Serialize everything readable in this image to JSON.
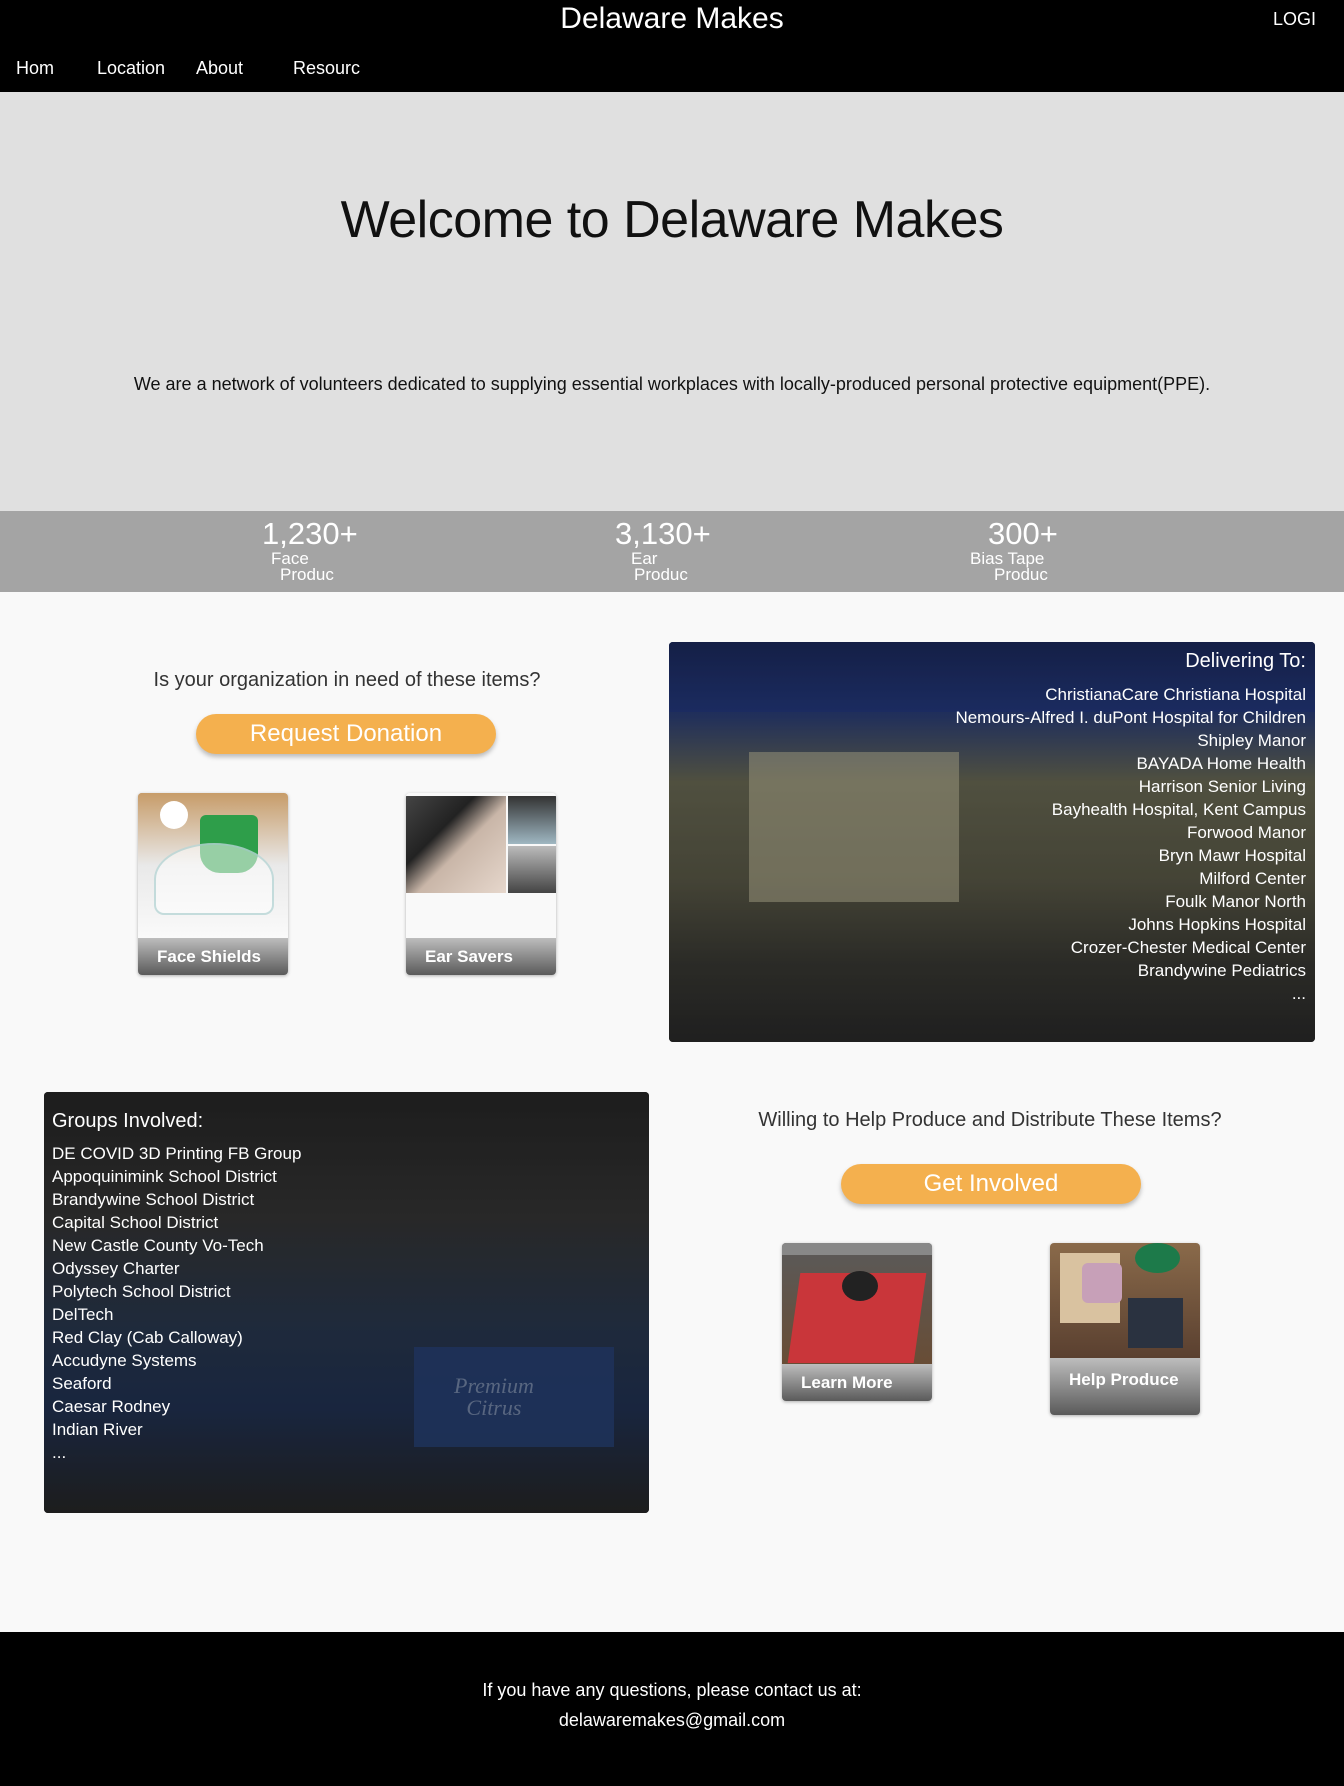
{
  "header": {
    "site_title": "Delaware Makes",
    "login_label": "LOGI",
    "nav": [
      "Hom",
      "Location",
      "About",
      "Resourc"
    ]
  },
  "hero": {
    "title": "Welcome to Delaware Makes",
    "text": "We are a network of volunteers dedicated to supplying essential workplaces with locally-produced personal protective equipment(PPE)."
  },
  "stats": [
    {
      "value": "1,230+",
      "label_line1": "Face",
      "label_line2": "Produc"
    },
    {
      "value": "3,130+",
      "label_line1": "Ear",
      "label_line2": "Produc"
    },
    {
      "value": "300+",
      "label_line1": "Bias Tape",
      "label_line2": "Produc"
    }
  ],
  "request": {
    "prompt": "Is your organization in need of these items?",
    "button_label": "Request Donation",
    "cards": [
      {
        "label": "Face Shields",
        "icon": "face-shield-photo"
      },
      {
        "label": "Ear Savers",
        "icon": "ear-saver-photo"
      }
    ]
  },
  "delivering": {
    "heading": "Delivering To:",
    "items": [
      "ChristianaCare Christiana Hospital",
      "Nemours-Alfred I. duPont Hospital for Children",
      "Shipley Manor",
      "BAYADA Home Health",
      "Harrison Senior Living",
      "Bayhealth Hospital, Kent Campus",
      "Forwood Manor",
      "Bryn Mawr Hospital",
      "Milford Center",
      "Foulk Manor North",
      "Johns Hopkins Hospital",
      "Crozer-Chester Medical Center",
      "Brandywine Pediatrics",
      "..."
    ]
  },
  "groups": {
    "heading": "Groups Involved:",
    "items": [
      "DE COVID 3D Printing FB Group",
      "Appoquinimink School District",
      "Brandywine School District",
      "Capital School District",
      "New Castle County Vo-Tech",
      "Odyssey Charter",
      "Polytech School District",
      "DelTech",
      "Red Clay (Cab Calloway)",
      "Accudyne Systems",
      "Seaford",
      "Caesar Rodney",
      "Indian River",
      "..."
    ],
    "box_text_line1": "Premium",
    "box_text_line2": "Citrus"
  },
  "involve": {
    "prompt": "Willing to Help Produce and Distribute These Items?",
    "button_label": "Get Involved",
    "cards": [
      {
        "label": "Learn More",
        "icon": "3d-printer-photo"
      },
      {
        "label": "Help Produce",
        "icon": "supplies-photo"
      }
    ]
  },
  "footer": {
    "line1": "If you have any questions, please contact us at:",
    "email": "delawaremakes@gmail.com"
  },
  "colors": {
    "accent": "#f4b04e",
    "header_bg": "#000000",
    "hero_bg": "#e0e0e0",
    "stats_bg": "#a4a4a4"
  }
}
